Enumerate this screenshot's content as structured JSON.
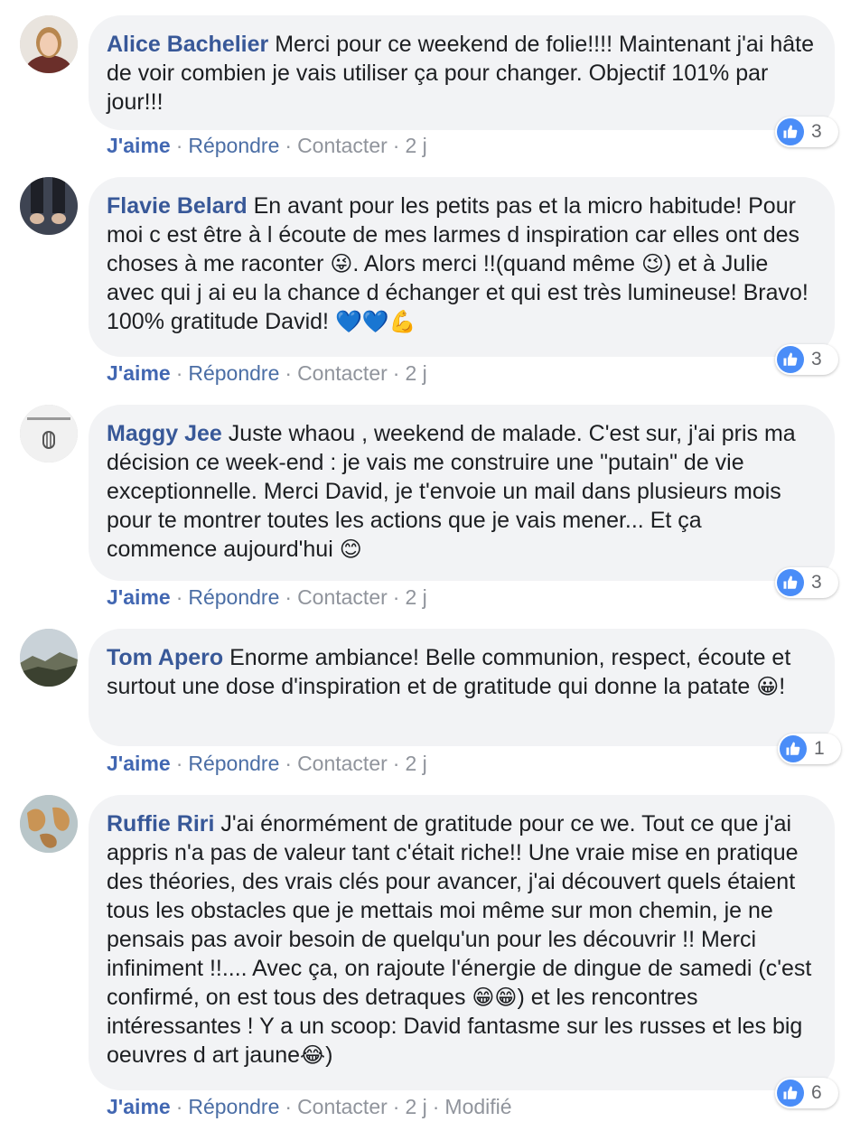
{
  "comments": [
    {
      "author": "Alice Bachelier",
      "parts": [
        {
          "text": "Merci pour ce weekend de folie!!!! Maintenant j'ai hâte de voir combien je vais utiliser ça pour changer. Objectif 101% par jour!!!"
        }
      ],
      "likes": "3",
      "actions": {
        "like": "J'aime",
        "reply": "Répondre",
        "contact": "Contacter",
        "time": "2 j"
      }
    },
    {
      "author": "Flavie Belard",
      "parts": [
        {
          "text": "En avant pour les petits pas et la micro habitude! Pour moi c est être à l écoute de mes larmes d inspiration car elles ont des choses à me raconter "
        },
        {
          "emoji": "😜",
          "icon": "winking-tongue-emoji"
        },
        {
          "text": ". Alors merci !!(quand même "
        },
        {
          "emoji": "😉",
          "icon": "wink-emoji"
        },
        {
          "text": ") et à Julie avec qui j ai eu la chance d échanger et qui est très lumineuse! Bravo! 100% gratitude David! "
        },
        {
          "emoji": "💙💙💪",
          "icon": "blue-hearts-flexed-biceps-emoji"
        }
      ],
      "likes": "3",
      "actions": {
        "like": "J'aime",
        "reply": "Répondre",
        "contact": "Contacter",
        "time": "2 j"
      }
    },
    {
      "author": "Maggy Jee",
      "parts": [
        {
          "text": "Juste whaou , weekend de malade. C'est sur, j'ai pris ma décision ce week-end : je vais me construire une \"putain\" de vie exceptionnelle. Merci David, je t'envoie un mail dans plusieurs mois pour te montrer toutes les actions que je vais mener... Et ça commence aujourd'hui "
        },
        {
          "emoji": "😊",
          "icon": "smiling-emoji"
        }
      ],
      "likes": "3",
      "actions": {
        "like": "J'aime",
        "reply": "Répondre",
        "contact": "Contacter",
        "time": "2 j"
      }
    },
    {
      "author": "Tom Apero",
      "parts": [
        {
          "text": "Enorme ambiance! Belle communion, respect, écoute et surtout une dose d'inspiration et de gratitude qui donne la patate "
        },
        {
          "emoji": "😀",
          "icon": "grinning-emoji"
        },
        {
          "text": "!"
        }
      ],
      "likes": "1",
      "actions": {
        "like": "J'aime",
        "reply": "Répondre",
        "contact": "Contacter",
        "time": "2 j"
      }
    },
    {
      "author": "Ruffie Riri",
      "parts": [
        {
          "text": "J'ai énormément de gratitude pour ce we. Tout ce que j'ai appris n'a pas de valeur tant c'était riche!! Une vraie mise en pratique des théories, des vrais clés pour avancer, j'ai découvert quels étaient tous les obstacles que je mettais moi même sur mon chemin, je ne pensais pas avoir besoin de quelqu'un pour les découvrir !! Merci infiniment !!.... Avec ça, on rajoute l'énergie de dingue de samedi (c'est confirmé, on est tous des detraques "
        },
        {
          "emoji": "😁😁",
          "icon": "beaming-emoji"
        },
        {
          "text": ") et les rencontres intéressantes ! Y a un scoop: David fantasme sur les russes et les big oeuvres d art jaune"
        },
        {
          "emoji": "😂",
          "icon": "tears-of-joy-emoji"
        },
        {
          "text": ")"
        }
      ],
      "likes": "6",
      "actions": {
        "like": "J'aime",
        "reply": "Répondre",
        "contact": "Contacter",
        "time": "2 j",
        "edited": "Modifié"
      }
    }
  ],
  "colors": {
    "author": "#385898",
    "like": "#4267b2",
    "bubble": "#f2f3f5",
    "badge": "#4a8df8"
  },
  "icons": {
    "like_badge": "thumbs-up-icon",
    "separator": "·"
  }
}
